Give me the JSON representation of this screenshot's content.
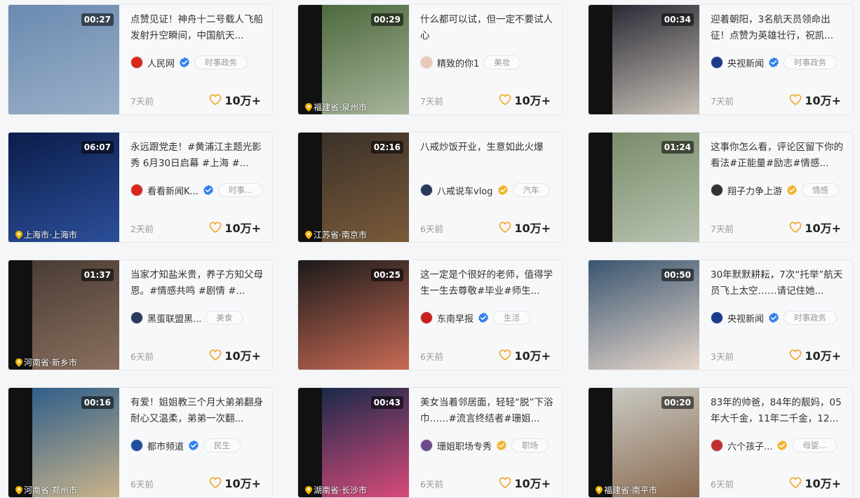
{
  "watermark": "",
  "cards": [
    {
      "duration": "00:27",
      "location": "",
      "title": "点赞见证！神舟十二号载人飞船发射升空瞬间，中国航天...",
      "author": "人民网",
      "verify": "blue",
      "tag": "时事政务",
      "time": "7天前",
      "likes": "10万+",
      "thumb_colors": [
        "#6a8ab0",
        "#9bb0c8"
      ],
      "avatar_color": "#d8261c"
    },
    {
      "duration": "00:29",
      "location": "福建省·泉州市",
      "title": "什么都可以试，但一定不要试人心",
      "author": "精致的你1",
      "verify": "",
      "tag": "美妆",
      "time": "7天前",
      "likes": "10万+",
      "thumb_colors": [
        "#4d6a3e",
        "#a7b49a"
      ],
      "avatar_color": "#e9c9b8"
    },
    {
      "duration": "00:34",
      "location": "",
      "title": "迎着朝阳，3名航天员领命出征！点赞为英雄壮行，祝凯...",
      "author": "央视新闻",
      "verify": "blue",
      "tag": "时事政务",
      "time": "7天前",
      "likes": "10万+",
      "thumb_colors": [
        "#2b2a35",
        "#c9c2b8"
      ],
      "avatar_color": "#1b3c8c"
    },
    {
      "duration": "06:07",
      "location": "上海市·上海市",
      "title": "永远跟党走！#黄浦江主题光影秀 6月30日启幕 #上海 #...",
      "author": "看看新闻K...",
      "verify": "blue",
      "tag": "时事...",
      "time": "2天前",
      "likes": "10万+",
      "thumb_colors": [
        "#0b1d4a",
        "#2c4f9a"
      ],
      "avatar_color": "#d8261c"
    },
    {
      "duration": "02:16",
      "location": "江苏省·南京市",
      "title": "八戒炒饭开业，生意如此火爆",
      "author": "八戒说车vlog",
      "verify": "gold",
      "tag": "汽车",
      "time": "6天前",
      "likes": "10万+",
      "thumb_colors": [
        "#3b3229",
        "#7a5a3a"
      ],
      "avatar_color": "#2a3a5a"
    },
    {
      "duration": "01:24",
      "location": "",
      "title": "这事你怎么看，评论区留下你的看法#正能量#励志#情感...",
      "author": "翔子力争上游",
      "verify": "gold",
      "tag": "情感",
      "time": "7天前",
      "likes": "10万+",
      "thumb_colors": [
        "#7a8b6a",
        "#b8c3b0"
      ],
      "avatar_color": "#333"
    },
    {
      "duration": "01:37",
      "location": "河南省·新乡市",
      "title": "当家才知盐米贵，养子方知父母恩。#情感共鸣 #剧情 #...",
      "author": "黑蛋联盟黑...",
      "verify": "",
      "tag": "美食",
      "time": "6天前",
      "likes": "10万+",
      "thumb_colors": [
        "#4a3d35",
        "#8a6f5e"
      ],
      "avatar_color": "#2a3a5a"
    },
    {
      "duration": "00:25",
      "location": "",
      "title": "这一定是个很好的老师，值得学生一生去尊敬#毕业#师生...",
      "author": "东南早报",
      "verify": "blue",
      "tag": "生活",
      "time": "6天前",
      "likes": "10万+",
      "thumb_colors": [
        "#1a1a1a",
        "#c96a55"
      ],
      "avatar_color": "#c8201c"
    },
    {
      "duration": "00:50",
      "location": "",
      "title": "30年默默耕耘，7次“托举”航天员飞上太空……请记住她...",
      "author": "央视新闻",
      "verify": "blue",
      "tag": "时事政务",
      "time": "3天前",
      "likes": "10万+",
      "thumb_colors": [
        "#3a5570",
        "#e8d8cc"
      ],
      "avatar_color": "#1b3c8c"
    },
    {
      "duration": "00:16",
      "location": "河南省·郑州市",
      "title": "有爱！姐姐教三个月大弟弟翻身耐心又温柔，弟弟一次翻...",
      "author": "都市频道",
      "verify": "blue",
      "tag": "民生",
      "time": "6天前",
      "likes": "10万+",
      "thumb_colors": [
        "#2f5f8a",
        "#c9b38a"
      ],
      "avatar_color": "#1f4fa0"
    },
    {
      "duration": "00:43",
      "location": "湖南省·长沙市",
      "title": "美女当着邻居面，轻轻“脱”下浴巾……#流言终结者#珊姐...",
      "author": "珊姐职场专秀",
      "verify": "gold",
      "tag": "职场",
      "time": "6天前",
      "likes": "10万+",
      "thumb_colors": [
        "#1a2a4a",
        "#d84a7a"
      ],
      "avatar_color": "#6b4a8a"
    },
    {
      "duration": "00:20",
      "location": "福建省·南平市",
      "title": "83年的帅爸，84年的靓妈，05年大千金，11年二千金，12...",
      "author": "六个孩子...",
      "verify": "gold",
      "tag": "母婴...",
      "time": "6天前",
      "likes": "10万+",
      "thumb_colors": [
        "#c9c9c2",
        "#8a6a50"
      ],
      "avatar_color": "#c03030"
    }
  ]
}
